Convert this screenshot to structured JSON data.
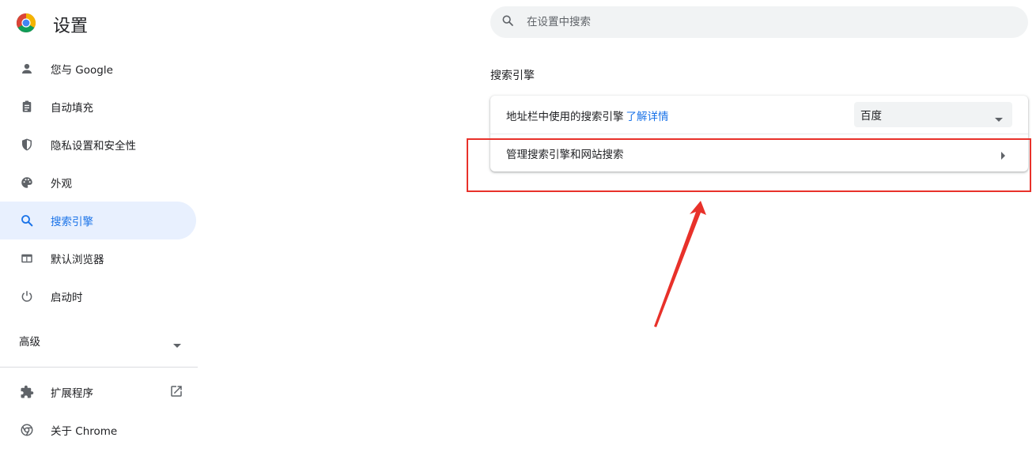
{
  "app": {
    "title": "设置"
  },
  "search": {
    "placeholder": "在设置中搜索"
  },
  "sidebar": {
    "items": [
      {
        "label": "您与 Google",
        "icon": "person-icon"
      },
      {
        "label": "自动填充",
        "icon": "clipboard-icon"
      },
      {
        "label": "隐私设置和安全性",
        "icon": "shield-icon"
      },
      {
        "label": "外观",
        "icon": "palette-icon"
      },
      {
        "label": "搜索引擎",
        "icon": "search-icon",
        "active": true
      },
      {
        "label": "默认浏览器",
        "icon": "browser-window-icon"
      },
      {
        "label": "启动时",
        "icon": "power-icon"
      }
    ],
    "advanced_label": "高级",
    "bottom_items": [
      {
        "label": "扩展程序",
        "icon": "puzzle-icon"
      },
      {
        "label": "关于 Chrome",
        "icon": "chrome-icon"
      }
    ]
  },
  "main": {
    "section_title": "搜索引擎",
    "address_bar_engine": {
      "label": "地址栏中使用的搜索引擎",
      "link": "了解详情",
      "selected": "百度"
    },
    "manage_label": "管理搜索引擎和网站搜索"
  },
  "colors": {
    "accent": "#1a73e8",
    "active_bg": "#e8f0fe",
    "annotation_red": "#e8312a"
  }
}
